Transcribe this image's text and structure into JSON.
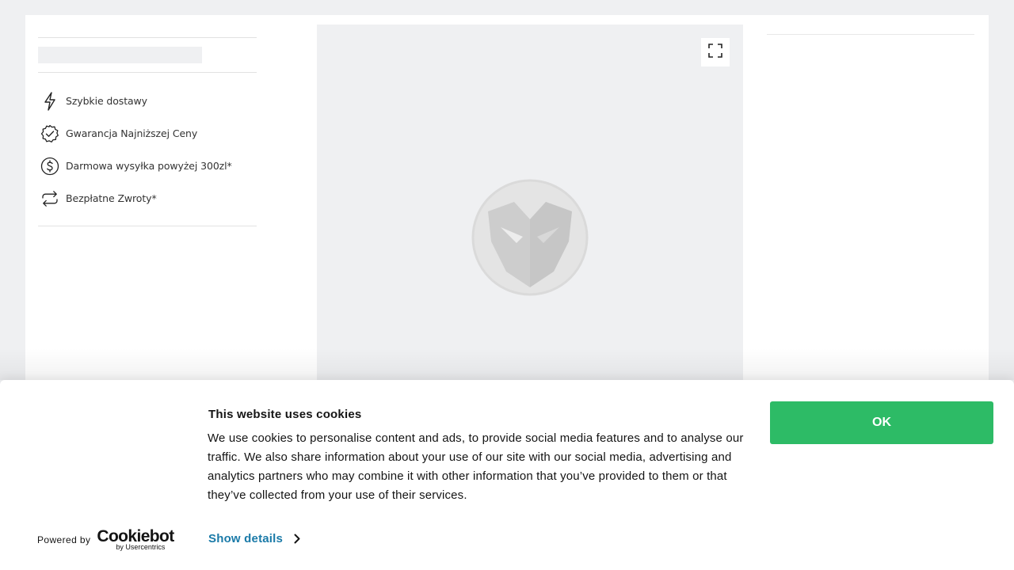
{
  "features": [
    {
      "icon": "lightning-icon",
      "label": "Szybkie dostawy"
    },
    {
      "icon": "badge-check-icon",
      "label": "Gwarancja Najniższej Ceny"
    },
    {
      "icon": "dollar-circle-icon",
      "label": "Darmowa wysyłka powyżej 300zl*"
    },
    {
      "icon": "return-arrows-icon",
      "label": "Bezpłatne Zwroty*"
    }
  ],
  "image_panel": {
    "expand_icon": "fullscreen-icon",
    "placeholder_icon": "mask-logo-placeholder-icon"
  },
  "cookie_banner": {
    "title": "This website uses cookies",
    "text": "We use cookies to personalise content and ads, to provide social media features and to analyse our traffic. We also share information about your use of our site with our social media, advertising and analytics partners who may combine it with other information that you’ve provided to them or that they’ve collected from your use of their services.",
    "ok_label": "OK",
    "show_details_label": "Show details",
    "powered_by_label": "Powered by",
    "cookiebot_word": "Cookiebot",
    "cookiebot_sub": "by Usercentrics"
  },
  "colors": {
    "accent_green": "#2dbb66",
    "link_blue": "#1a7aa8",
    "page_bg": "#eff0f2"
  }
}
